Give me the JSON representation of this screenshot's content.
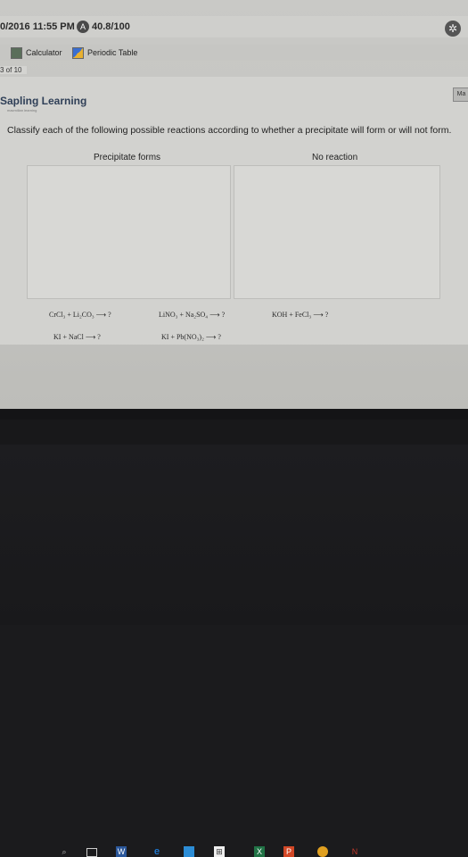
{
  "header": {
    "timestamp": "0/2016 11:55 PM",
    "score_icon": "A",
    "score": "40.8/100",
    "settings_icon": "gear-icon"
  },
  "toolbar": {
    "calculator_label": "Calculator",
    "periodic_table_label": "Periodic Table"
  },
  "page_indicator": "3 of 10",
  "brand": {
    "logo": "Sapling Learning",
    "logo_sub": "macmillan learning",
    "corner_tab": "Ma"
  },
  "question": {
    "instruction": "Classify each of the following possible reactions according to whether a precipitate will form or will not form.",
    "bins": [
      "Precipitate forms",
      "No reaction"
    ],
    "reactions": [
      "CrCl₃ + Li₂CO₃ ⟶ ?",
      "LiNO₃ + Na₂SO₄ ⟶ ?",
      "KOH + FeCl₃ ⟶ ?",
      "KI + NaCl ⟶ ?",
      "KI + Pb(NO₃)₂ ⟶ ?"
    ]
  },
  "taskbar": {
    "icons": [
      "search-icon",
      "task-view-icon",
      "word-icon",
      "edge-icon",
      "photos-icon",
      "store-icon",
      "excel-icon",
      "powerpoint-icon",
      "chrome-icon",
      "app-icon"
    ],
    "colors": {
      "word": "#2b579a",
      "edge": "#1e90ff",
      "excel": "#217346",
      "powerpoint": "#d24726",
      "chrome": "#e0a020",
      "app": "#c0392b"
    }
  }
}
